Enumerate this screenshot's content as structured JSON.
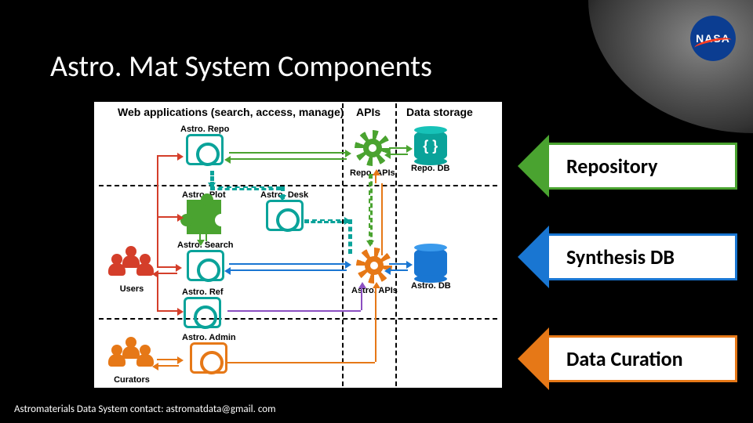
{
  "title": "Astro. Mat System Components",
  "sections": {
    "web": "Web applications (search, access, manage)",
    "apis": "APIs",
    "storage": "Data storage"
  },
  "nodes": {
    "astro_repo": "Astro. Repo",
    "repo_apis": "Repo. APIs",
    "repo_db": "Repo. DB",
    "astro_plot": "Astro. Plot",
    "astro_desk": "Astro. Desk",
    "astro_search": "Astro. Search",
    "astro_apis": "Astro. APIs",
    "astro_db": "Astro. DB",
    "users": "Users",
    "astro_ref": "Astro. Ref",
    "astro_admin": "Astro. Admin",
    "curators": "Curators"
  },
  "callouts": {
    "repository": "Repository",
    "synthesis": "Synthesis DB",
    "curation": "Data Curation"
  },
  "footer": "Astromaterials Data System contact: astromatdata@gmail. com",
  "logo": "NASA"
}
